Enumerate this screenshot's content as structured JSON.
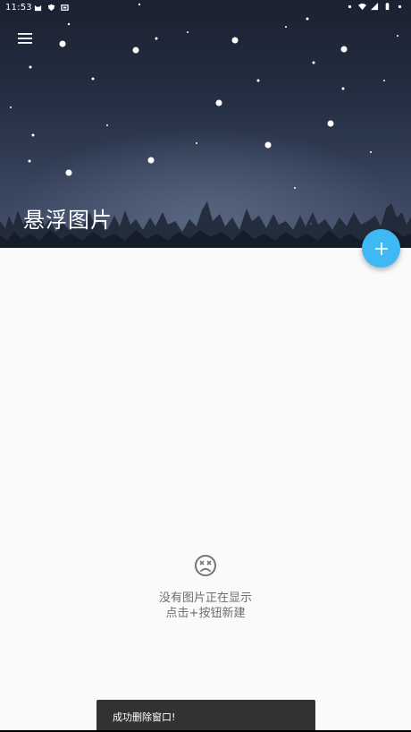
{
  "status_bar": {
    "time": "11:53",
    "left_icons": [
      "cat-icon",
      "shield-icon",
      "cast-icon"
    ],
    "right_icons": [
      "dot-icon",
      "wifi-icon",
      "signal-icon",
      "battery-icon",
      "dot-icon"
    ]
  },
  "header": {
    "title": "悬浮图片",
    "menu_icon": "menu-icon"
  },
  "fab": {
    "label": "+",
    "icon": "plus-icon",
    "color": "#40b8f3"
  },
  "empty_state": {
    "icon": "sad-face-icon",
    "line1": "没有图片正在显示",
    "line2": "点击+按钮新建"
  },
  "snackbar": {
    "message": "成功删除窗口!"
  },
  "colors": {
    "header_dark": "#1a2130",
    "header_light": "#46526c",
    "page_background": "#fafafa",
    "fab": "#40b8f3",
    "snackbar": "#323232"
  }
}
